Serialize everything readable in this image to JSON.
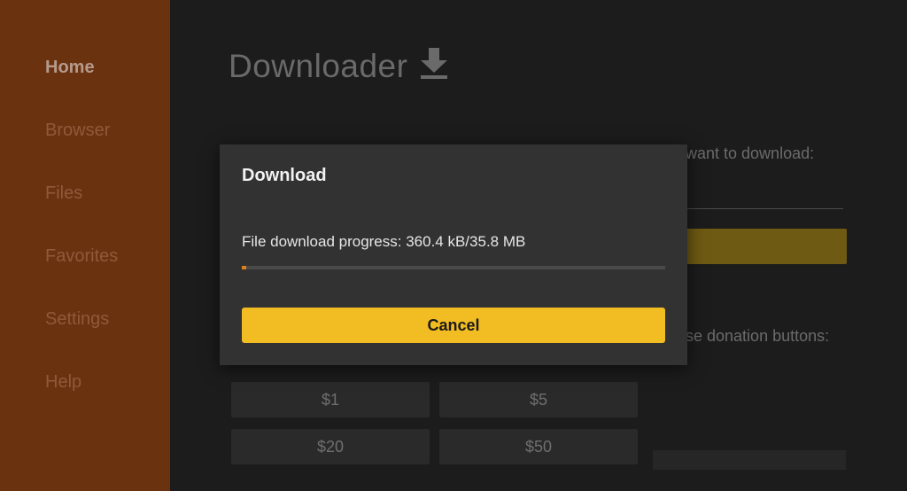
{
  "sidebar": {
    "items": [
      {
        "label": "Home",
        "active": true
      },
      {
        "label": "Browser",
        "active": false
      },
      {
        "label": "Files",
        "active": false
      },
      {
        "label": "Favorites",
        "active": false
      },
      {
        "label": "Settings",
        "active": false
      },
      {
        "label": "Help",
        "active": false
      }
    ]
  },
  "header": {
    "title": "Downloader",
    "icon": "download-icon"
  },
  "background": {
    "url_prompt": "want to download:",
    "donation_prompt": "se donation buttons:",
    "donate_buttons": [
      "$1",
      "$5",
      "$20",
      "$50"
    ]
  },
  "dialog": {
    "title": "Download",
    "progress_text": "File download progress: 360.4 kB/35.8 MB",
    "progress_fraction": 0.01,
    "cancel_label": "Cancel"
  },
  "colors": {
    "sidebar": "#6b3210",
    "accent": "#f2bc23",
    "progress": "#e0801c"
  }
}
